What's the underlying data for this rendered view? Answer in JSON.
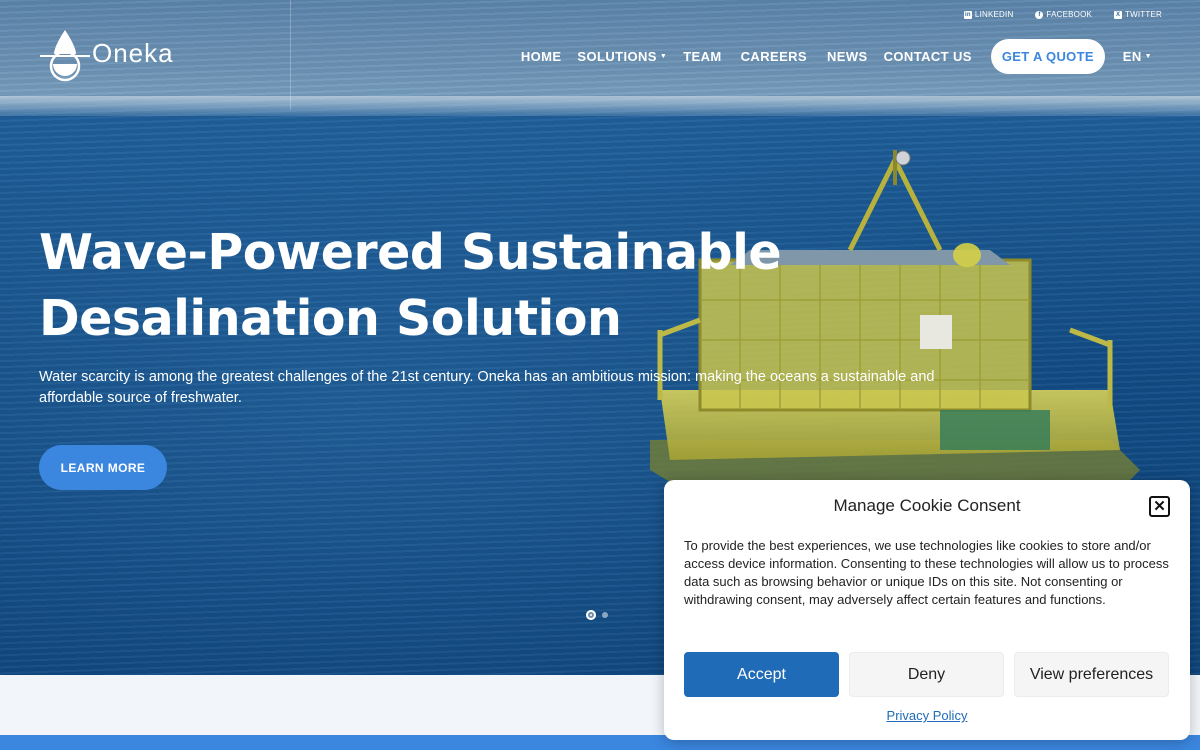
{
  "social": {
    "linkedin": "LINKEDIN",
    "facebook": "FACEBOOK",
    "twitter": "TWITTER"
  },
  "logo": {
    "text": "Oneka"
  },
  "nav": {
    "home": "HOME",
    "solutions": "SOLUTIONS",
    "team": "TEAM",
    "careers": "CAREERS",
    "news": "NEWS",
    "contact": "CONTACT US",
    "quote": "GET A QUOTE",
    "language": "EN"
  },
  "hero": {
    "headline_line1": "Wave-Powered Sustainable",
    "headline_line2": "Desalination Solution",
    "subtitle": "Water scarcity is among the greatest challenges of the 21st century. Oneka has an ambitious mission: making the oceans a sustainable and affordable source of freshwater.",
    "button": "LEARN MORE",
    "slide_current": 1,
    "slide_count": 2
  },
  "cookie": {
    "title": "Manage Cookie Consent",
    "text": "To provide the best experiences, we use technologies like cookies to store and/or access device information. Consenting to these technologies will allow us to process data such as browsing behavior or unique IDs on this site. Not consenting or withdrawing consent, may adversely affect certain features and functions.",
    "accept": "Accept",
    "deny": "Deny",
    "preferences": "View preferences",
    "privacy": "Privacy Policy"
  },
  "colors": {
    "accent": "#3b86df",
    "cookie_accept": "#1f6bb8",
    "sea": "#124d86"
  }
}
